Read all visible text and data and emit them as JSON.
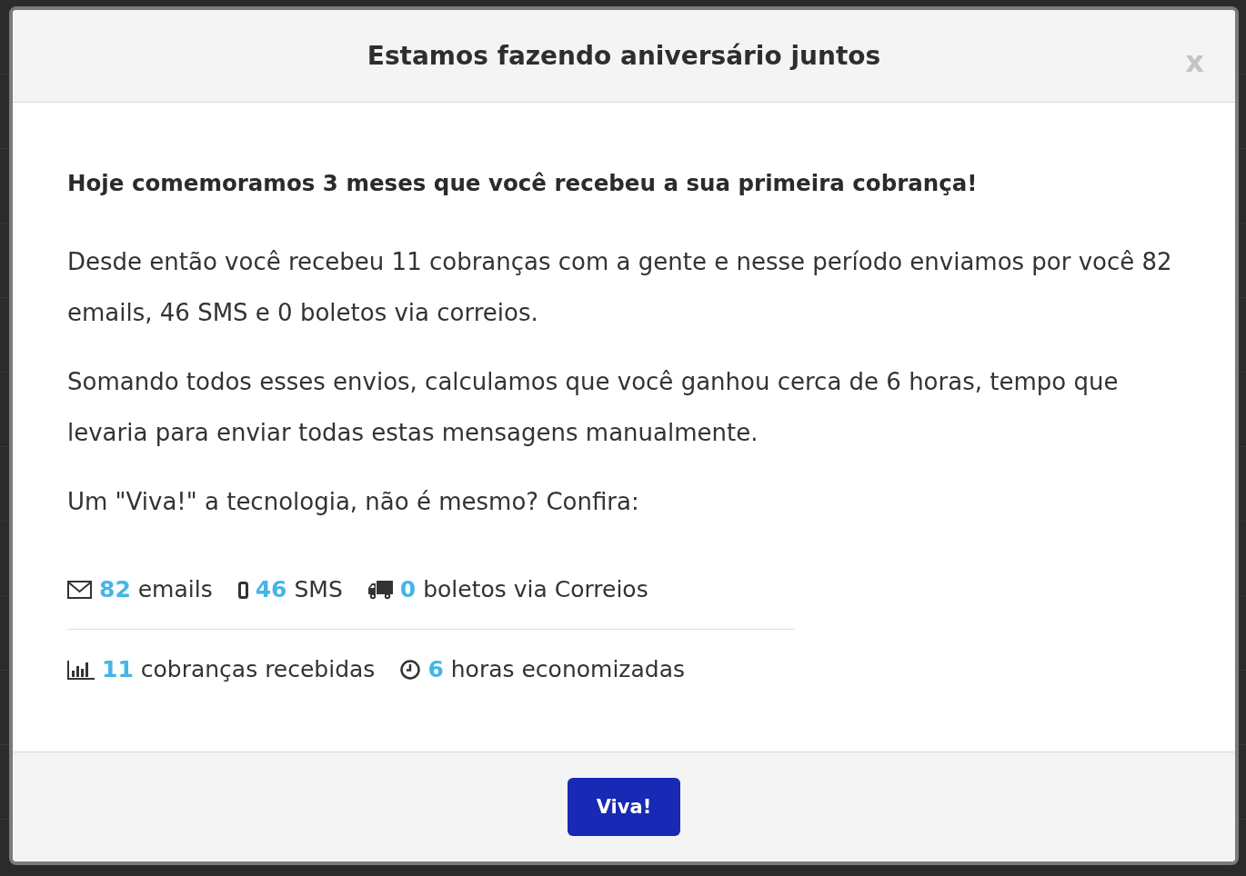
{
  "modal": {
    "title": "Estamos fazendo aniversário juntos",
    "close": "x"
  },
  "body": {
    "heading": "Hoje comemoramos 3 meses que você recebeu a sua primeira cobrança!",
    "paragraphs": [
      "Desde então você recebeu 11 cobranças com a gente e nesse período enviamos por você 82 emails, 46 SMS e 0 boletos via correios.",
      "Somando todos esses envios, calculamos que você ganhou cerca de 6 horas, tempo que levaria para enviar todas estas mensagens manualmente.",
      "Um \"Viva!\" a tecnologia, não é mesmo? Confira:"
    ]
  },
  "stats": [
    [
      {
        "kind": "email",
        "text": "**82** emails"
      },
      {
        "kind": "sms",
        "text": "**46** SMS"
      },
      {
        "kind": "post",
        "text": "**0** boletos via Correios"
      }
    ],
    [
      {
        "kind": "charges",
        "text": "**11** cobranças recebidas"
      },
      {
        "kind": "hours",
        "text": "**6** horas economizadas"
      }
    ]
  ],
  "footer": {
    "button": "Viva!"
  }
}
